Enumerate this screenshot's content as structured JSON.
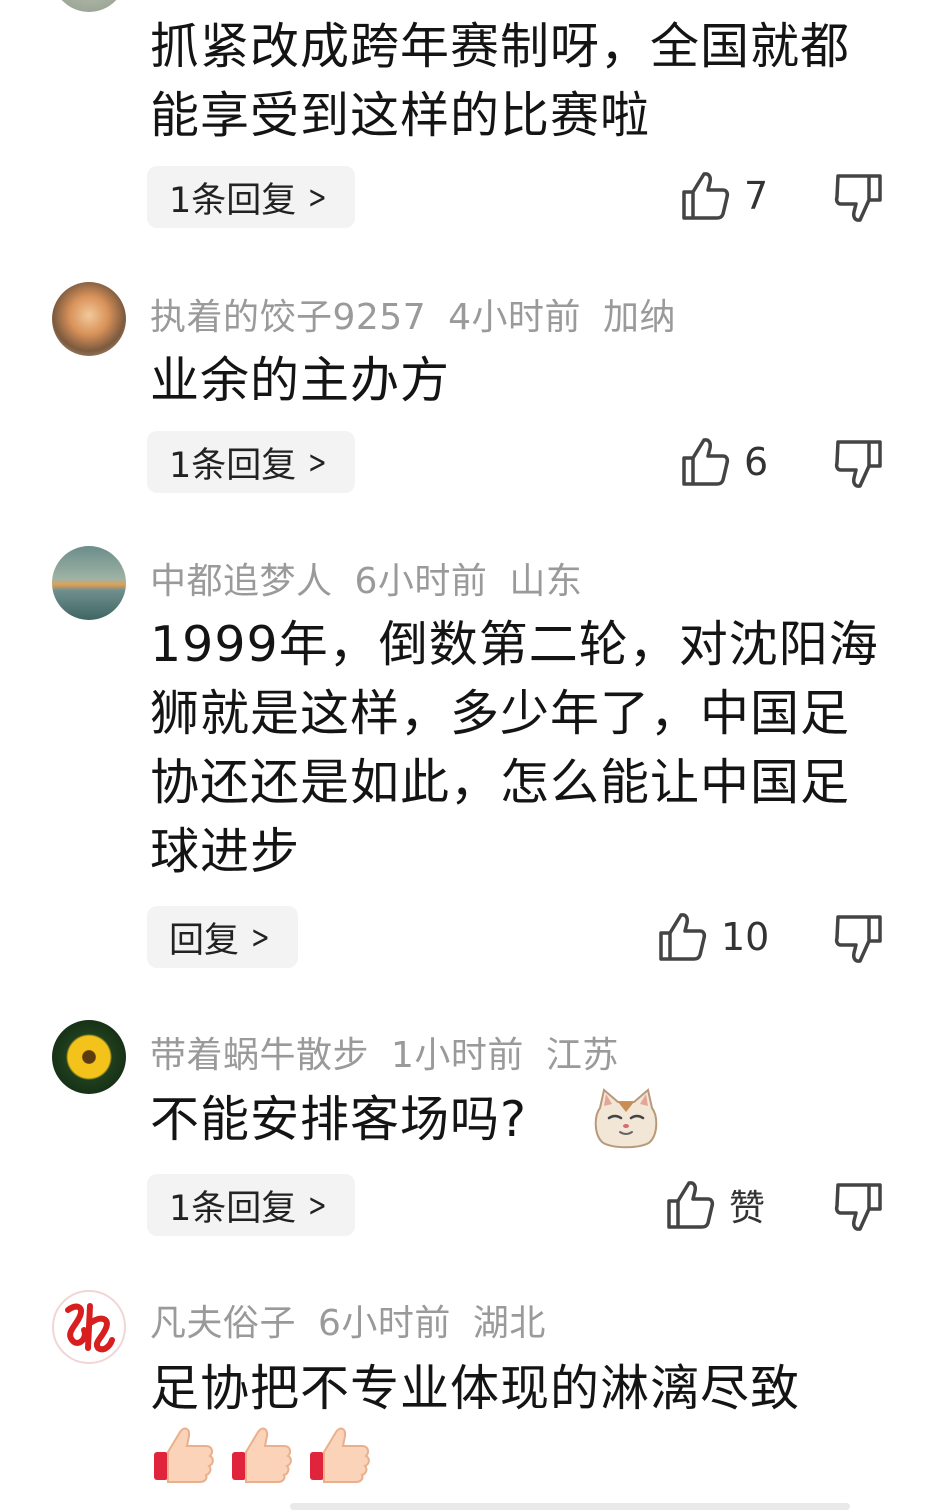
{
  "comments": [
    {
      "text": "抓紧改成跨年赛制呀，全国就都能享受到这样的比赛啦",
      "reply_label": "1条回复",
      "likes": "7"
    },
    {
      "user": "执着的饺子9257",
      "time": "4小时前",
      "location": "加纳",
      "text": "业余的主办方",
      "reply_label": "1条回复",
      "likes": "6"
    },
    {
      "user": "中都追梦人",
      "time": "6小时前",
      "location": "山东",
      "text": "1999年，倒数第二轮，对沈阳海狮就是这样，多少年了，中国足协还还是如此，怎么能让中国足球进步",
      "reply_label": "回复",
      "likes": "10"
    },
    {
      "user": "带着蜗牛散步",
      "time": "1小时前",
      "location": "江苏",
      "text": "不能安排客场吗?",
      "reply_label": "1条回复",
      "likes": "赞"
    },
    {
      "user": "凡夫俗子",
      "time": "6小时前",
      "location": "湖北",
      "text": "足协把不专业体现的淋漓尽致"
    }
  ],
  "icons": {
    "chevron": "chevron-right-icon",
    "like": "thumb-up-icon",
    "dislike": "thumb-down-icon"
  },
  "colors": {
    "meta": "#9a9a9a",
    "reply_bg": "#f3f3f3",
    "icon": "#444444"
  }
}
